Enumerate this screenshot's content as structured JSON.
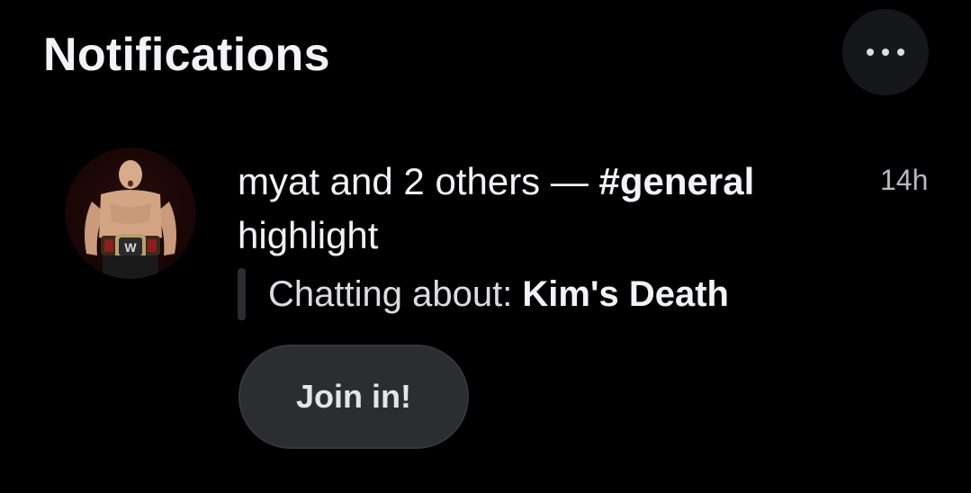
{
  "header": {
    "title": "Notifications",
    "more_icon": "more-horizontal-icon"
  },
  "notification": {
    "avatar_icon": "user-avatar",
    "actor_text": "myat and 2 others — ",
    "channel": "#general",
    "action": "highlight",
    "time": "14h",
    "quote_prefix": "Chatting about: ",
    "quote_topic": "Kim's Death",
    "join_label": "Join in!"
  },
  "colors": {
    "background": "#000000",
    "button_bg": "#2b2d31",
    "muted_text": "#b5bac1"
  }
}
